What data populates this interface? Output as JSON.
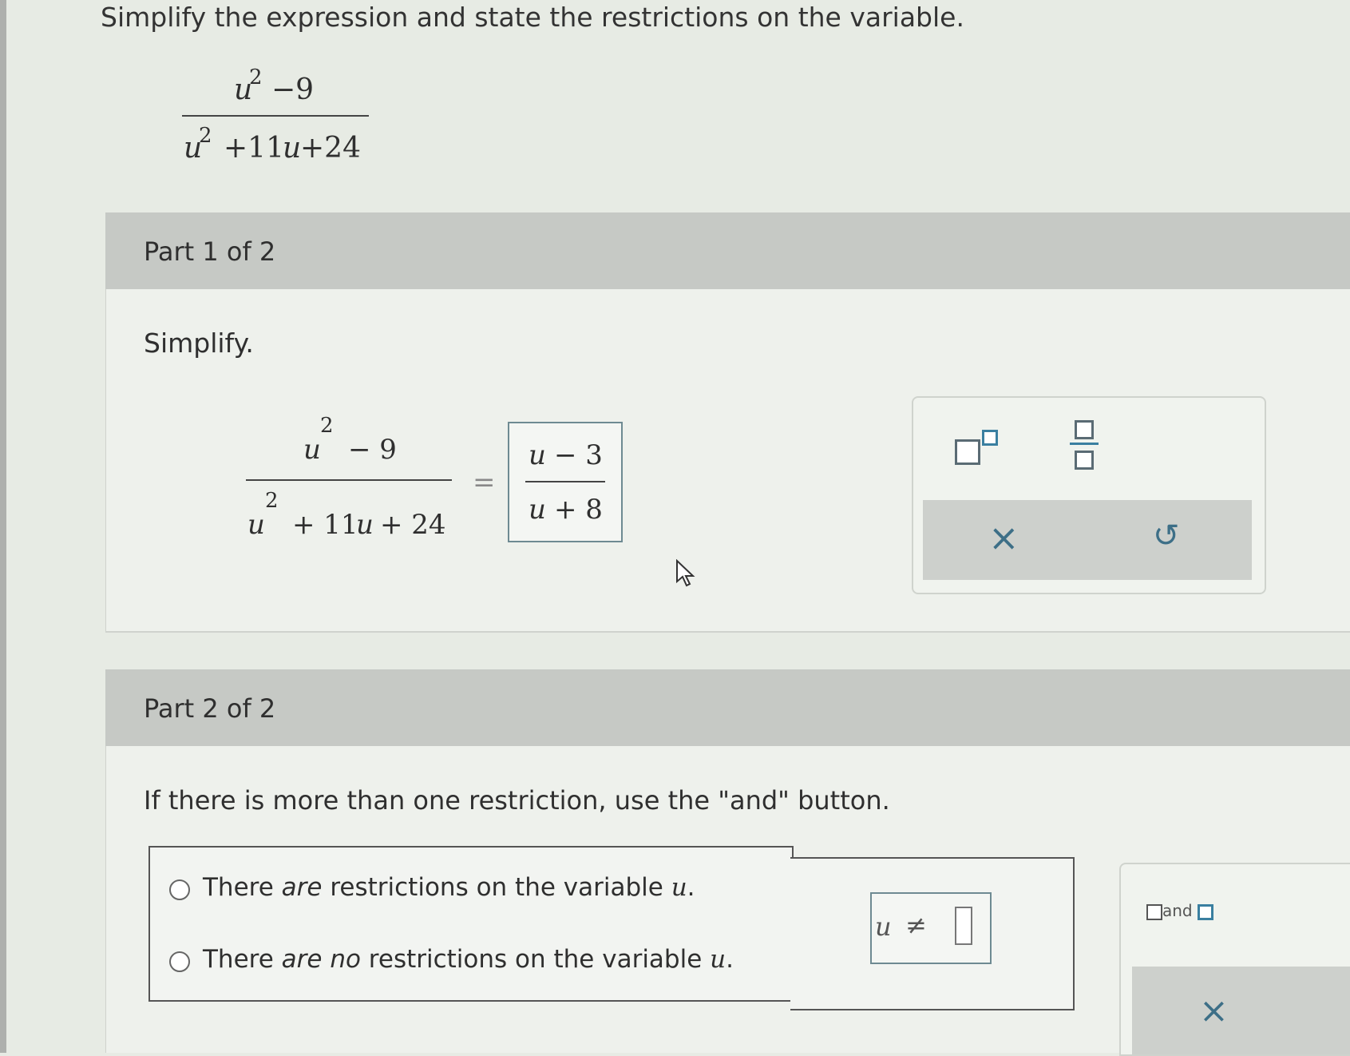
{
  "prompt": "Simplify the expression and state the restrictions on the variable.",
  "expression": {
    "numerator": {
      "var": "u",
      "exp": "2",
      "rest": "−9"
    },
    "denominator": {
      "var": "u",
      "exp": "2",
      "rest": "+11",
      "var2": "u",
      "tail": "+24"
    }
  },
  "part1": {
    "label": "Part 1 of 2",
    "instruction": "Simplify.",
    "lhs": {
      "num_var": "u",
      "num_exp": "2",
      "num_rest": "− 9",
      "den_var": "u",
      "den_exp": "2",
      "den_rest": "+ 11",
      "den_var2": "u",
      "den_tail": "+ 24"
    },
    "equals": "=",
    "answer": {
      "num_var": "u",
      "num_rest": "− 3",
      "den_var": "u",
      "den_rest": "+ 8"
    },
    "tools": {
      "clear": "×",
      "undo": "↺"
    }
  },
  "part2": {
    "label": "Part 2 of 2",
    "instruction": "If there is more than one restriction, use the \"and\" button.",
    "choices": [
      {
        "pre": "There ",
        "em": "are",
        "post": " restrictions on the variable ",
        "var": "u",
        "end": "."
      },
      {
        "pre": "There ",
        "em": "are no",
        "post": " restrictions on the variable ",
        "var": "u",
        "end": "."
      }
    ],
    "neq": {
      "var": "u",
      "symbol": "≠"
    },
    "and_label": "and",
    "clear": "×"
  }
}
